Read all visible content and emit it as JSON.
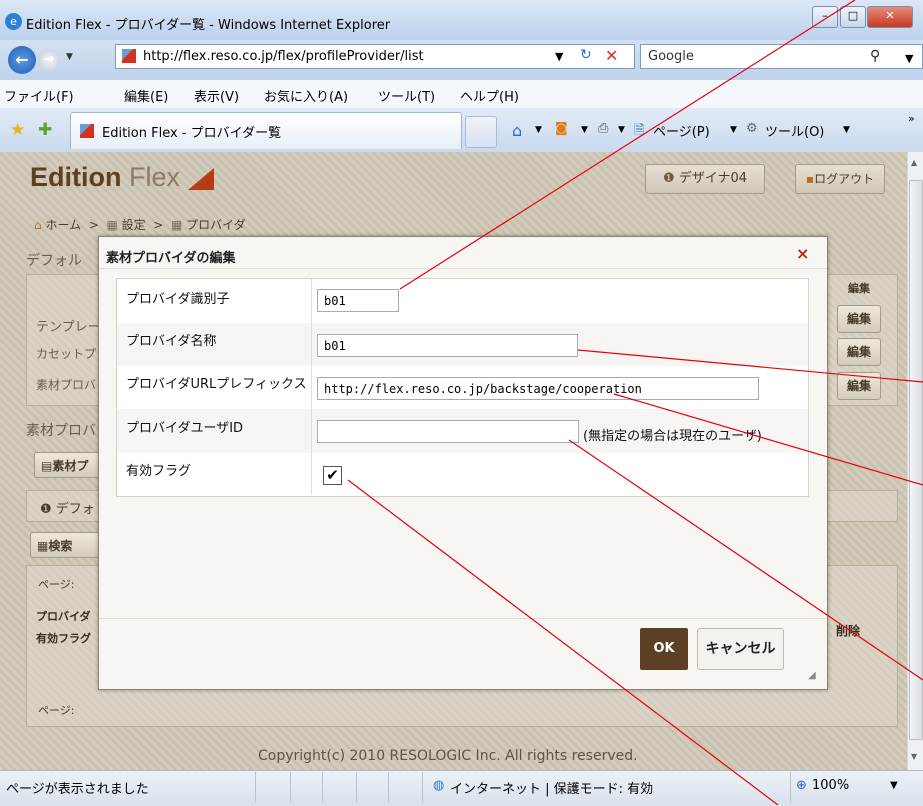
{
  "window": {
    "title": "Edition Flex - プロバイダー覧 - Windows Internet Explorer",
    "min": "–",
    "max": "□",
    "close": "✕"
  },
  "address": {
    "url": "http://flex.reso.co.jp/flex/profileProvider/list",
    "search_value": "Google"
  },
  "menu": [
    "ファイル(F)",
    "編集(E)",
    "表示(V)",
    "お気に入り(A)",
    "ツール(T)",
    "ヘルプ(H)"
  ],
  "tab": {
    "title": "Edition Flex - プロバイダー覧"
  },
  "commandbar": {
    "page": "ページ(P)",
    "tools": "ツール(O)"
  },
  "app": {
    "logo_edition": "Edition ",
    "logo_flex": "Flex",
    "designer_button": "デザイナ04",
    "logout_button": "ログアウト",
    "breadcrumb": [
      "ホーム",
      "設定",
      "プロバイダ"
    ],
    "breadcrumb_sep": ">",
    "bg_section_default": "デフォル",
    "bg_header_edit": "編集",
    "bg_rows": [
      "テンプレー",
      "カセットプ",
      "素材プロバ"
    ],
    "bg_row_edit": "編集",
    "bg_section_material": "素材プロバ",
    "bg_material_btn": "素材プ",
    "bg_default_btn": "デフォ",
    "bg_search_btn": "検索",
    "bg_page_label": "ページ:",
    "bg_col_provider": "プロバイダ",
    "bg_col_active": "有効フラグ",
    "bg_col_delete": "削除",
    "bg_page_label2": "ページ:",
    "copyright": "Copyright(c) 2010 RESOLOGIC Inc. All rights reserved."
  },
  "dialog": {
    "title": "素材プロバイダの編集",
    "close": "×",
    "fields": {
      "provider_id_label": "プロバイダ識別子",
      "provider_id_value": "b01",
      "provider_name_label": "プロバイダ名称",
      "provider_name_value": "b01",
      "url_prefix_label": "プロバイダURLプレフィックス",
      "url_prefix_value": "http://flex.reso.co.jp/backstage/cooperation",
      "user_id_label": "プロバイダユーザID",
      "user_id_value": "",
      "user_id_hint": "(無指定の場合は現在のユーザ)",
      "active_label": "有効フラグ",
      "active_checked": true
    },
    "ok_label": "OK",
    "cancel_label": "キャンセル"
  },
  "statusbar": {
    "text": "ページが表示されました",
    "zone": "インターネット | 保護モード: 有効",
    "zoom": "100%"
  },
  "colors": {
    "accent_brown": "#5d4024",
    "close_red": "#c0250e",
    "annotation_red": "#e8000a"
  }
}
